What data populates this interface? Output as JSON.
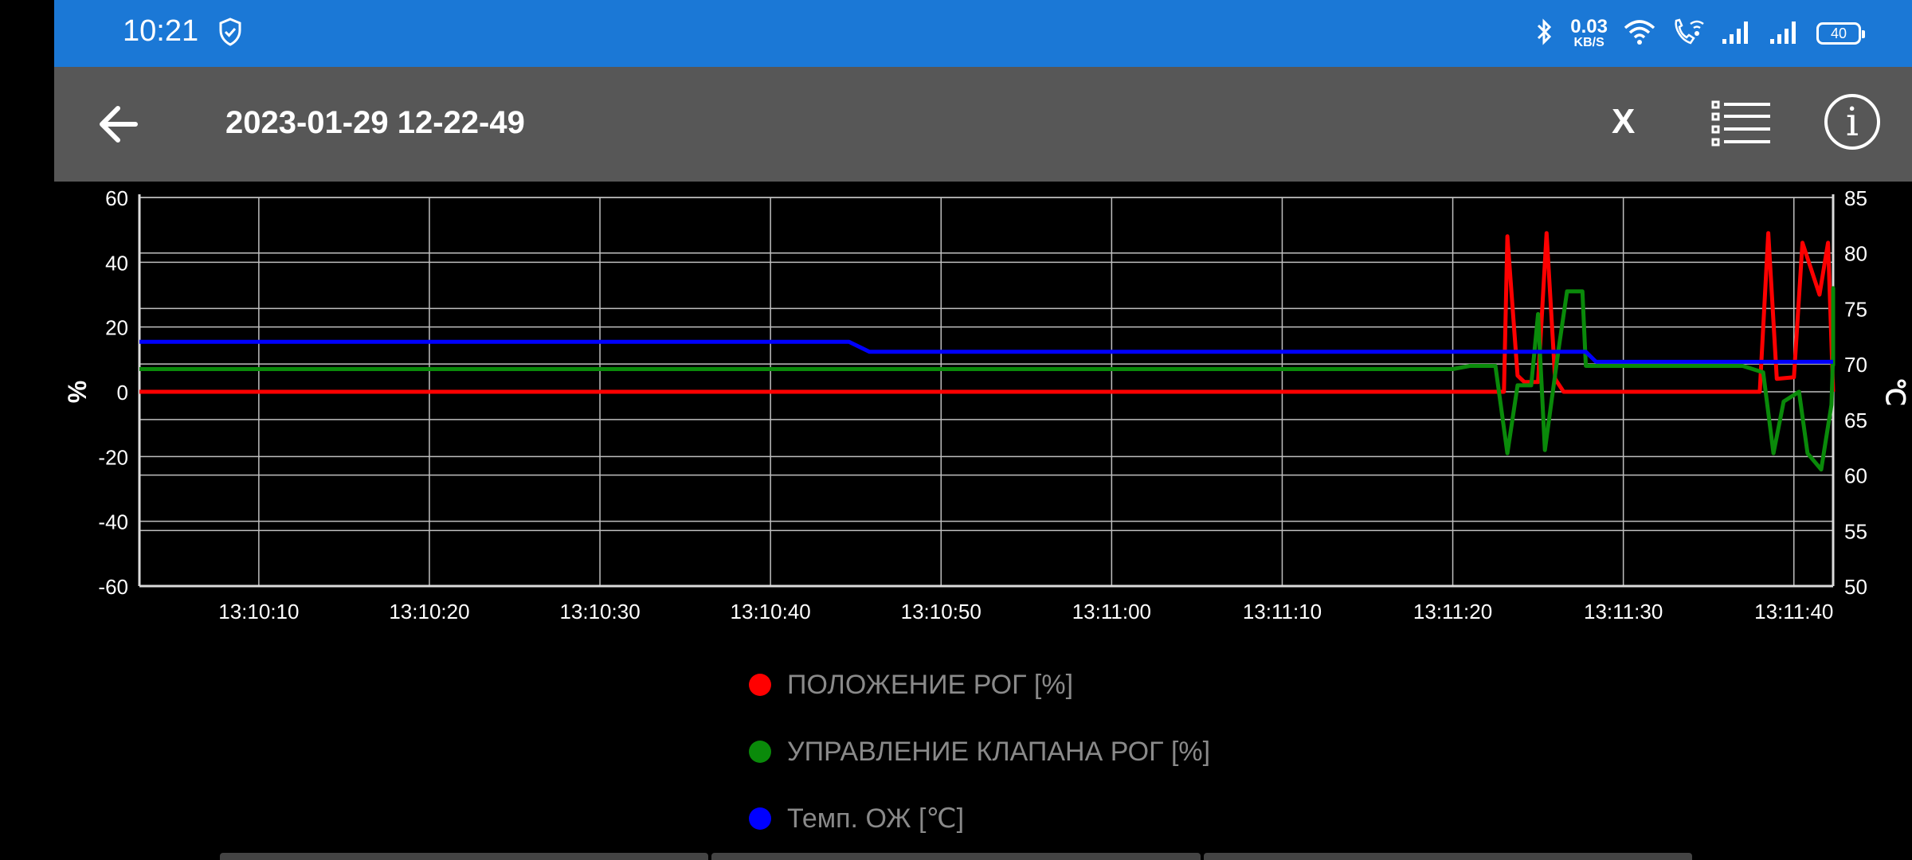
{
  "status_bar": {
    "time": "10:21",
    "net_speed_value": "0.03",
    "net_speed_unit": "KB/S",
    "battery": "40",
    "icons": [
      "shield-check-icon",
      "bluetooth-icon",
      "wifi-icon",
      "wifi-calling-icon",
      "signal-icon",
      "signal-icon",
      "battery-icon"
    ]
  },
  "app_bar": {
    "title": "2023-01-29 12-22-49",
    "close_label": "X",
    "info_label": "i",
    "icons": [
      "arrow-left-icon",
      "list-icon",
      "info-icon"
    ]
  },
  "colors": {
    "status_bar": "#1b78d6",
    "app_bar": "#575757",
    "background": "#000000",
    "red": "#ff0000",
    "green": "#0a8a0a",
    "blue": "#0000ff"
  },
  "legend": [
    {
      "label": "ПОЛОЖЕНИЕ РОГ [%]",
      "color": "#ff0000"
    },
    {
      "label": "УПРАВЛЕНИЕ КЛАПАНА РОГ [%]",
      "color": "#0a8a0a"
    },
    {
      "label": "Темп. ОЖ [℃]",
      "color": "#0000ff"
    }
  ],
  "chart_data": {
    "type": "line",
    "ylabel_left": "%",
    "ylabel_right": "℃",
    "x_ticks": [
      "13:10:10",
      "13:10:20",
      "13:10:30",
      "13:10:40",
      "13:10:50",
      "13:11:00",
      "13:11:10",
      "13:11:20",
      "13:11:30",
      "13:11:40"
    ],
    "x_range_seconds_after_13_10": [
      3,
      102.3
    ],
    "y_left_ticks": [
      60,
      40,
      20,
      0,
      -20,
      -40,
      -60
    ],
    "y_left_range": [
      -60,
      60
    ],
    "y_right_ticks": [
      85,
      80,
      75,
      70,
      65,
      60,
      55,
      50
    ],
    "y_right_range": [
      50,
      85
    ],
    "grid": true,
    "series": [
      {
        "name": "ПОЛОЖЕНИЕ РОГ [%]",
        "color": "#ff0000",
        "axis": "left",
        "points": [
          [
            3,
            0
          ],
          [
            83,
            0
          ],
          [
            83.2,
            48
          ],
          [
            83.8,
            5
          ],
          [
            84.2,
            3
          ],
          [
            85,
            3
          ],
          [
            85.5,
            49
          ],
          [
            86,
            4
          ],
          [
            86.5,
            0
          ],
          [
            98,
            0
          ],
          [
            98.5,
            49
          ],
          [
            99,
            4
          ],
          [
            100,
            4.5
          ],
          [
            100.5,
            46
          ],
          [
            101.5,
            30
          ],
          [
            102,
            46
          ],
          [
            103,
            0
          ],
          [
            105,
            0
          ]
        ]
      },
      {
        "name": "УПРАВЛЕНИЕ КЛАПАНА РОГ [%]",
        "color": "#0a8a0a",
        "axis": "left",
        "points": [
          [
            3,
            7
          ],
          [
            80,
            7
          ],
          [
            81,
            8
          ],
          [
            82.5,
            8
          ],
          [
            83.2,
            -19
          ],
          [
            83.8,
            2
          ],
          [
            84.6,
            2
          ],
          [
            85.0,
            24
          ],
          [
            85.4,
            -18
          ],
          [
            86.2,
            13
          ],
          [
            86.7,
            31
          ],
          [
            87.6,
            31
          ],
          [
            87.8,
            8
          ],
          [
            88.5,
            8
          ],
          [
            97,
            8
          ],
          [
            98.2,
            6
          ],
          [
            98.8,
            -19
          ],
          [
            99.4,
            -3
          ],
          [
            100.3,
            0
          ],
          [
            100.8,
            -19
          ],
          [
            101.6,
            -24
          ],
          [
            102.2,
            -4
          ],
          [
            103.2,
            12
          ],
          [
            103.6,
            32
          ],
          [
            104.2,
            32
          ],
          [
            105,
            8
          ]
        ]
      },
      {
        "name": "Темп. ОЖ [℃]",
        "color": "#0000ff",
        "axis": "right",
        "points": [
          [
            3,
            72
          ],
          [
            44.6,
            72
          ],
          [
            45.8,
            71.1
          ],
          [
            87.8,
            71.1
          ],
          [
            88.4,
            70.2
          ],
          [
            105,
            70.2
          ]
        ]
      }
    ]
  }
}
